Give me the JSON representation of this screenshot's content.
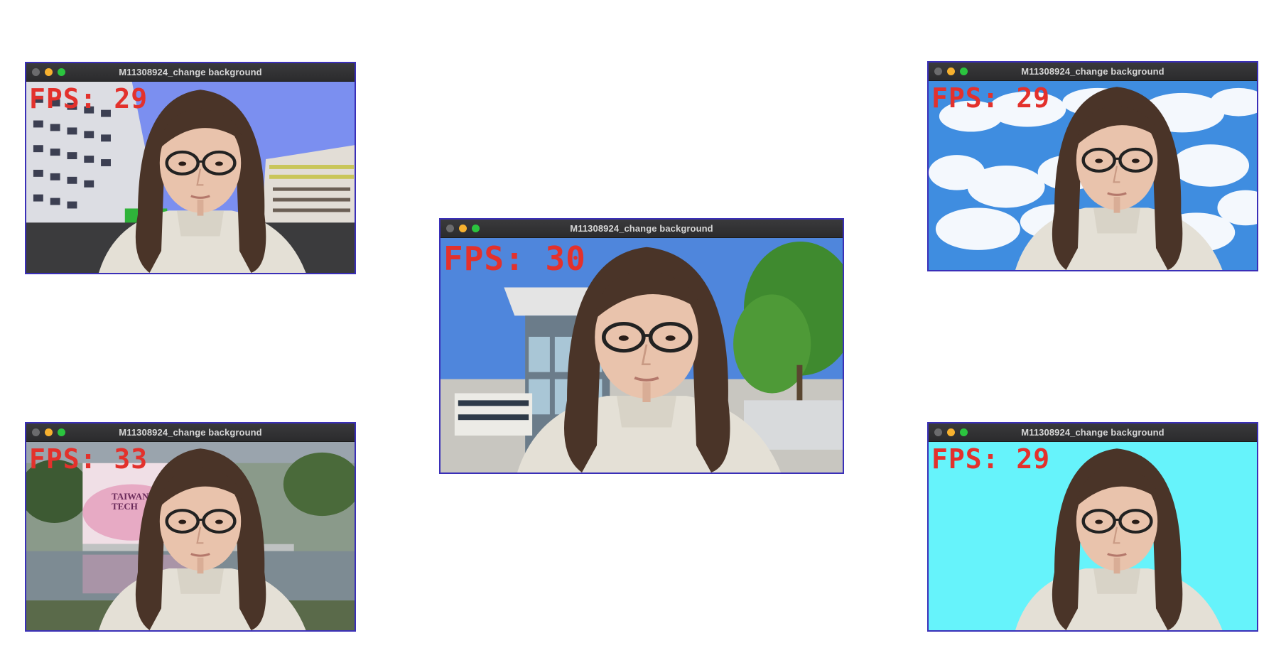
{
  "windows": [
    {
      "title": "M11308924_change background",
      "fps_label": "FPS: 29",
      "background": "building"
    },
    {
      "title": "M11308924_change background",
      "fps_label": "FPS: 30",
      "background": "campus"
    },
    {
      "title": "M11308924_change background",
      "fps_label": "FPS: 29",
      "background": "clouds"
    },
    {
      "title": "M11308924_change background",
      "fps_label": "FPS: 33",
      "background": "taiwan-tech"
    },
    {
      "title": "M11308924_change background",
      "fps_label": "FPS: 29",
      "background": "cyan"
    }
  ],
  "sign_text": "TAIWAN TECH",
  "colors": {
    "fps_text": "#e3312c",
    "titlebar": "#2b2b2d",
    "window_border": "#3a2fb8",
    "cyan_bg": "#66f3fb"
  },
  "icons": [
    "close-light-icon",
    "minimize-light-icon",
    "maximize-light-icon",
    "webcam-person-icon"
  ]
}
